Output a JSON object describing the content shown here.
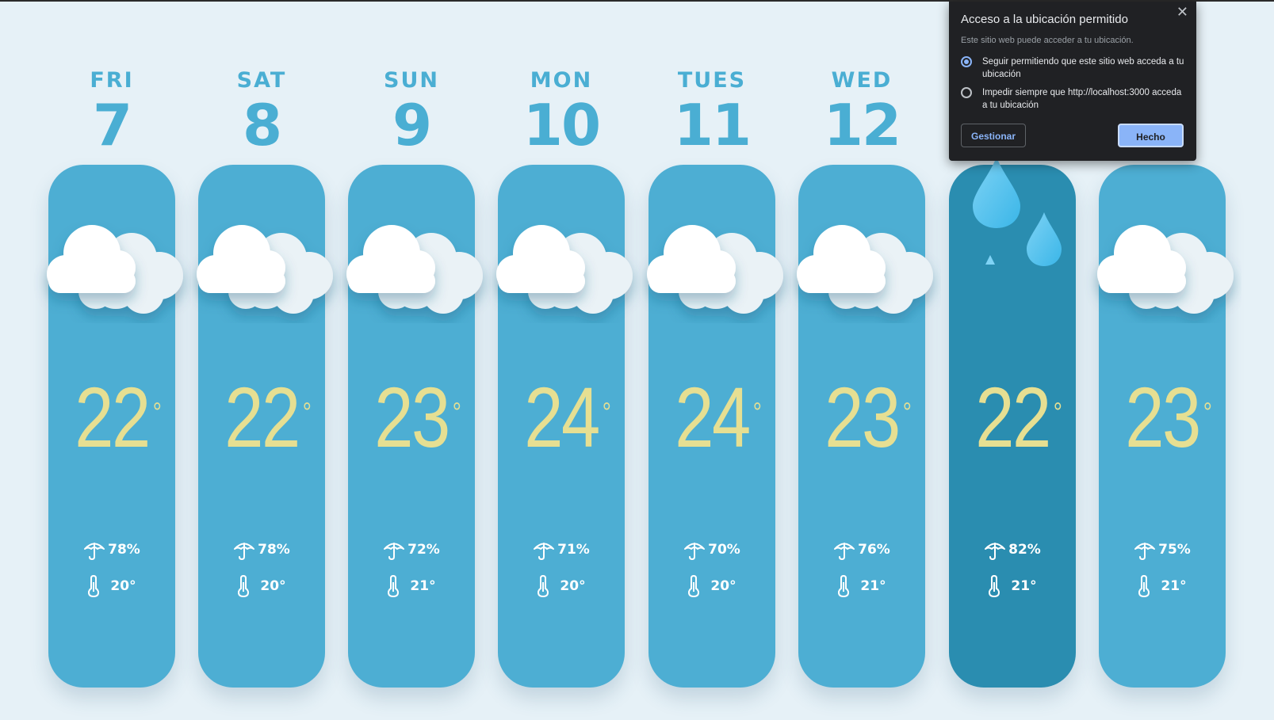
{
  "days": [
    {
      "name": "FRI",
      "num": "7",
      "temp": "22",
      "deg": "°",
      "rain": "78%",
      "low": "20°",
      "icon": "cloud-icon",
      "highlight": false
    },
    {
      "name": "SAT",
      "num": "8",
      "temp": "22",
      "deg": "°",
      "rain": "78%",
      "low": "20°",
      "icon": "cloud-icon",
      "highlight": false
    },
    {
      "name": "SUN",
      "num": "9",
      "temp": "23",
      "deg": "°",
      "rain": "72%",
      "low": "21°",
      "icon": "cloud-icon",
      "highlight": false
    },
    {
      "name": "MON",
      "num": "10",
      "temp": "24",
      "deg": "°",
      "rain": "71%",
      "low": "20°",
      "icon": "cloud-icon",
      "highlight": false
    },
    {
      "name": "TUES",
      "num": "11",
      "temp": "24",
      "deg": "°",
      "rain": "70%",
      "low": "20°",
      "icon": "cloud-icon",
      "highlight": false
    },
    {
      "name": "WED",
      "num": "12",
      "temp": "23",
      "deg": "°",
      "rain": "76%",
      "low": "21°",
      "icon": "cloud-icon",
      "highlight": false
    },
    {
      "name": "",
      "num": "",
      "temp": "22",
      "deg": "°",
      "rain": "82%",
      "low": "21°",
      "icon": "raindrop-icon",
      "highlight": true
    },
    {
      "name": "",
      "num": "",
      "temp": "23",
      "deg": "°",
      "rain": "75%",
      "low": "21°",
      "icon": "cloud-icon",
      "highlight": false
    }
  ],
  "popup": {
    "title": "Acceso a la ubicación permitido",
    "close": "✕",
    "subtitle": "Este sitio web puede acceder a tu ubicación.",
    "option1": "Seguir permitiendo que este sitio web acceda a tu ubicación",
    "option2": "Impedir siempre que http://localhost:3000 acceda a tu ubicación",
    "manage": "Gestionar",
    "done": "Hecho"
  },
  "colors": {
    "background": "#e6f1f7",
    "card": "#4daed3",
    "card_highlight": "#2a8db0",
    "day_text": "#4aaed3",
    "temp_text": "#e6df92",
    "popup_bg": "#202124",
    "accent": "#8ab4f8"
  }
}
